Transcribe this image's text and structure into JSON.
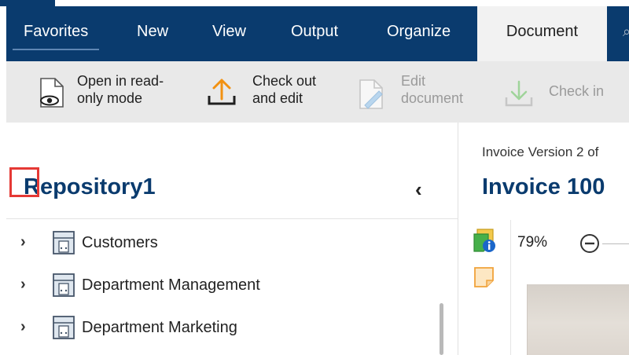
{
  "nav": {
    "tabs": [
      "Favorites",
      "New",
      "View",
      "Output",
      "Organize",
      "Document"
    ],
    "active_tab": "Document"
  },
  "ribbon": {
    "open_readonly": "Open in read-\nonly mode",
    "check_out_edit": "Check out\nand edit",
    "edit_document": "Edit\ndocument",
    "check_in": "Check in"
  },
  "left": {
    "repository_title": "Repository1",
    "tree_items": [
      "Customers",
      "Department Management",
      "Department Marketing"
    ]
  },
  "right": {
    "subtitle": "Invoice Version 2 of",
    "title": "Invoice 100",
    "zoom": "79%"
  },
  "colors": {
    "nav_bg": "#0a3b6e",
    "ribbon_bg": "#e9e9e9",
    "title_blue": "#0a3b6e",
    "checkout_orange": "#f29111",
    "highlight_red": "#e53935"
  },
  "icons": {
    "open_readonly": "eye-document-icon",
    "check_out_edit": "upload-arrow-icon",
    "edit_document": "edit-document-icon",
    "check_in": "download-arrow-icon",
    "tree": "cabinet-icon",
    "info": "info-sticky-icon",
    "note": "sticky-note-icon",
    "zoom_out": "zoom-out-icon"
  }
}
